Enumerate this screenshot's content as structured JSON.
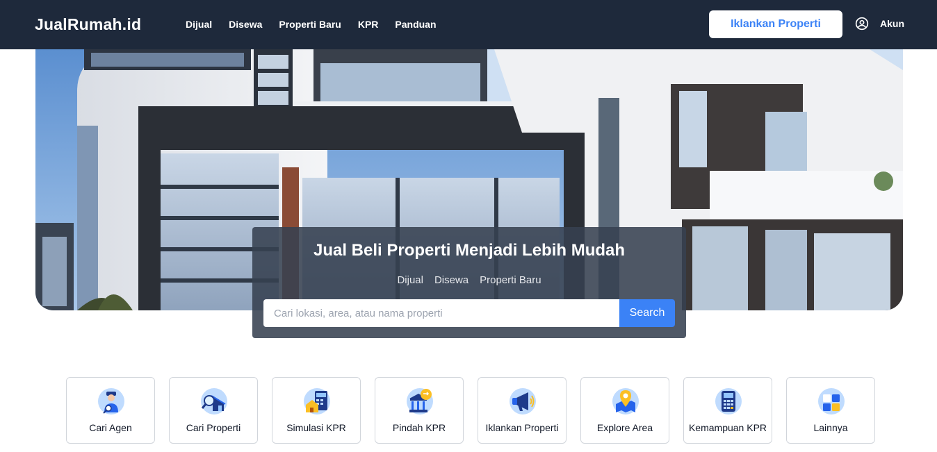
{
  "navbar": {
    "brand": "JualRumah.id",
    "links": [
      "Dijual",
      "Disewa",
      "Properti Baru",
      "KPR",
      "Panduan"
    ],
    "cta_label": "Iklankan Properti",
    "account_label": "Akun"
  },
  "hero": {
    "title": "Jual Beli Properti Menjadi Lebih Mudah",
    "tabs": [
      "Dijual",
      "Disewa",
      "Properti Baru"
    ],
    "search": {
      "placeholder": "Cari lokasi, area, atau nama properti",
      "value": "",
      "button_label": "Search"
    }
  },
  "features": [
    {
      "label": "Cari Agen",
      "icon": "agent-icon"
    },
    {
      "label": "Cari Properti",
      "icon": "property-search-icon"
    },
    {
      "label": "Simulasi KPR",
      "icon": "calculator-house-icon"
    },
    {
      "label": "Pindah KPR",
      "icon": "bank-transfer-icon"
    },
    {
      "label": "Iklankan Properti",
      "icon": "megaphone-icon"
    },
    {
      "label": "Explore Area",
      "icon": "map-pin-icon"
    },
    {
      "label": "Kemampuan KPR",
      "icon": "calculator-icon"
    },
    {
      "label": "Lainnya",
      "icon": "grid-icon"
    }
  ],
  "colors": {
    "navbar_bg": "#1e293b",
    "accent": "#3b82f6",
    "icon_circle": "#bfdbfe"
  }
}
